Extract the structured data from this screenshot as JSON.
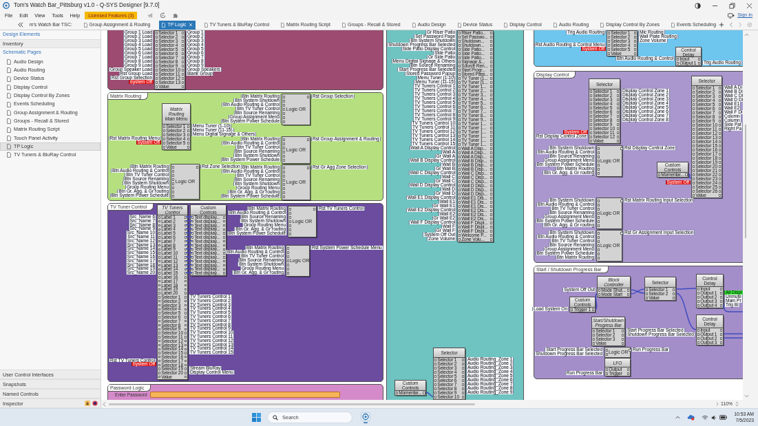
{
  "window": {
    "title": "Tom's Watch Bar_Pittsburg v1.0 - Q-SYS Designer [9.7.0]",
    "menu": [
      "File",
      "Edit",
      "View",
      "Tools",
      "Help"
    ],
    "license_badge": "Licensed Features (3)",
    "sign_in": "Sign In"
  },
  "tabs": [
    {
      "label": "m's Watch Bar TSC:",
      "kind": "partial",
      "selected": false
    },
    {
      "label": "Group Assignment & Routing",
      "kind": "page",
      "selected": false
    },
    {
      "label": "TP Logic",
      "kind": "page",
      "selected": true
    },
    {
      "label": "TV Tuners & BluRay Control",
      "kind": "page",
      "selected": false
    },
    {
      "label": "Matrix Routing Script",
      "kind": "page",
      "selected": false
    },
    {
      "label": "Groups - Recall & Stored",
      "kind": "page",
      "selected": false
    },
    {
      "label": "Audio Design",
      "kind": "page",
      "selected": false
    },
    {
      "label": "Device Status",
      "kind": "page",
      "selected": false
    },
    {
      "label": "Display Control",
      "kind": "page",
      "selected": false
    },
    {
      "label": "Audio Routing",
      "kind": "page",
      "selected": false
    },
    {
      "label": "Display Control By Zones",
      "kind": "page",
      "selected": false
    },
    {
      "label": "Events Scheduling",
      "kind": "page",
      "selected": false
    }
  ],
  "sidebar": {
    "headers": [
      {
        "label": "Design Elements",
        "kind": "link"
      },
      {
        "label": "Inventory",
        "kind": "header"
      },
      {
        "label": "Schematic Pages",
        "kind": "link"
      }
    ],
    "pages": [
      {
        "label": "Audio Design",
        "selected": false
      },
      {
        "label": "Audio Routing",
        "selected": false
      },
      {
        "label": "Device Status",
        "selected": false
      },
      {
        "label": "Display Control",
        "selected": false
      },
      {
        "label": "Display Control By Zones",
        "selected": false
      },
      {
        "label": "Events Scheduling",
        "selected": false
      },
      {
        "label": "Group Assignment & Routing",
        "selected": false
      },
      {
        "label": "Groups - Recall & Stored",
        "selected": false
      },
      {
        "label": "Matrix Routing Script",
        "selected": false
      },
      {
        "label": "Touch Panel Activity",
        "selected": false
      },
      {
        "label": "TP Logic",
        "selected": true
      },
      {
        "label": "TV Tuners & BluRay Control",
        "selected": false
      }
    ],
    "panels": [
      {
        "label": "User Control Interfaces",
        "kind": "section"
      },
      {
        "label": "Snapshots",
        "kind": "section"
      },
      {
        "label": "Named Controls",
        "kind": "section"
      },
      {
        "label": "Inspector",
        "kind": "inspector"
      }
    ]
  },
  "canvas": {
    "zoom": "110%",
    "groups": [
      {
        "color": "#9d4b71",
        "blocks": [
          {
            "kind": "component",
            "rows": [
              {
                "in": "Group 1 Load",
                "label": "Selector 1",
                "out": "Group 1"
              },
              {
                "in": "Group 2 Load",
                "label": "Selector 2",
                "out": "Group 2"
              },
              {
                "in": "Group 3 Load",
                "label": "Selector 3",
                "out": "Group 3"
              },
              {
                "in": "Group 4 Load",
                "label": "Selector 4",
                "out": "Group 4"
              },
              {
                "in": "Group 5 Load",
                "label": "Selector 5",
                "out": "Group 5"
              },
              {
                "in": "Group 6 Load",
                "label": "Selector 6",
                "out": "Group 6"
              },
              {
                "in": "Group 7 Load",
                "label": "Selector 7",
                "out": "Group 7"
              },
              {
                "in": "Group 8 Load",
                "label": "Selector 8",
                "out": "Group 8"
              },
              {
                "in": "Group 9 Load",
                "label": "Selector 9",
                "out": "Group 9"
              },
              {
                "in": "Group Speaker Load",
                "label": "Selector 10",
                "out": "Group Speakers"
              },
              {
                "in": "Rst Group Load",
                "label": "Selector 11",
                "out": "Blank Group"
              },
              {
                "in": "Rst Group Selection",
                "label": "Selector 12"
              },
              {
                "tag": "System Off",
                "label": "Selector 13"
              },
              {
                "label": "Value"
              }
            ]
          }
        ]
      },
      {
        "title": "Matrix Routing",
        "color": "#b6e07f",
        "blocks": [
          {
            "kind": "renamed",
            "title": "Matrix Routing Main Menu",
            "rows": [
              {
                "label": "Selector 1",
                "out": "Menu Tuner (1-10)"
              },
              {
                "label": "Selector 2",
                "out": "Menu Tuner (11-15)"
              },
              {
                "label": "Selector 3",
                "out": "Menu Digital Signage & Others"
              },
              {
                "in": "Rst Matrix Routing Menu",
                "label": "Selector 4"
              },
              {
                "tag": "System Off",
                "label": "Selector 5"
              },
              {
                "label": "Value"
              }
            ]
          },
          {
            "kind": "logic",
            "title": "Logic OR",
            "rows": [
              {
                "in": "Btn Matrix Routing",
                "out": "Rst Group Selection"
              },
              {
                "in": "Btn System Shutdown"
              },
              {
                "in": "Btn Audio Routing & Control"
              },
              {
                "in": "Btn TV Tuner Control"
              },
              {
                "in": "Btn Source Renaming"
              },
              {
                "in": "Group Assignment Menu"
              },
              {
                "in": "Btn System Power Schedule"
              }
            ]
          },
          {
            "kind": "logic",
            "title": "Logic OR",
            "rows": [
              {
                "in": "Btn Matrix Routing",
                "out": "Rst Group Assignment & Routing"
              },
              {
                "in": "Btn Audio Routing & Control"
              },
              {
                "in": "Btn TV Tuner Control"
              },
              {
                "in": "Btn Source Renaming"
              },
              {
                "in": "Btn System Shutdown"
              },
              {
                "in": "Btn System Power Schedule"
              }
            ]
          },
          {
            "kind": "logic",
            "title": "Logic OR",
            "rows": [
              {
                "in": "Btn Matrix Routing",
                "out": "Rst Zone Selection"
              },
              {
                "in": "Btn Audio Routing & Control"
              },
              {
                "in": "Btn TV Tuner Control"
              },
              {
                "in": "Btn Source Renaming"
              },
              {
                "in": "Btn System Shutdown"
              },
              {
                "in": "Group Routing Menu"
              },
              {
                "in": "Btn Gr. Agg. & Gr routing"
              },
              {
                "in": "Btn System Power Schedule"
              }
            ]
          },
          {
            "kind": "logic",
            "title": "Logic OR",
            "rows": [
              {
                "in": "Btn Matrix Routing",
                "out": "Rst Gr Agg Zone Selection"
              },
              {
                "in": "Btn Audio Routing & Control"
              },
              {
                "in": "Btn TV Tuner Control"
              },
              {
                "in": "Btn Source Renaming"
              },
              {
                "in": "Btn System Shutdown"
              },
              {
                "in": "Group Routing Menu"
              },
              {
                "in": "Btn Gr. Agg. & Gr routing"
              },
              {
                "in": "Btn System Power Schedule"
              }
            ]
          }
        ]
      },
      {
        "title": "TV Tuner Control",
        "color": "#6b4c9f",
        "blocks": [
          {
            "kind": "renamed",
            "title": "TV Tuners Control",
            "rows": [
              {
                "in": "Src_Name 6",
                "label": "Label 1"
              },
              {
                "in": "Src_Name 7",
                "label": "Label 2"
              },
              {
                "in": "Src_Name 8",
                "label": "Label 3"
              },
              {
                "in": "Src_Name 9",
                "label": "Label 4"
              },
              {
                "in": "Src_Name 10",
                "label": "Label 5"
              },
              {
                "in": "Src_Name 11",
                "label": "Label 6"
              },
              {
                "in": "Src_Name 12",
                "label": "Label 7"
              },
              {
                "in": "Src_Name 13",
                "label": "Label 8"
              },
              {
                "in": "Src_Name 14",
                "label": "Label 9"
              },
              {
                "in": "Src_Name 15",
                "label": "Label 10"
              },
              {
                "in": "Src_Name 16",
                "label": "Label 11"
              },
              {
                "in": "Src_Name 17",
                "label": "Label 12"
              },
              {
                "in": "Src_Name 18",
                "label": "Label 13"
              },
              {
                "in": "Src_Name 19",
                "label": "Label 14"
              },
              {
                "in": "Src_Name 20",
                "label": "Label 15"
              },
              {
                "label": "Label 16"
              },
              {
                "label": "Label 17"
              },
              {
                "label": "Label 18"
              },
              {
                "label": "Label 19"
              },
              {
                "label": "Label 20"
              },
              {
                "label": "Selector 1",
                "out": "TV Tuners Control 1"
              },
              {
                "label": "Selector 2",
                "out": "TV Tuners Control 2"
              },
              {
                "label": "Selector 3",
                "out": "TV Tuners Control 3"
              },
              {
                "label": "Selector 4",
                "out": "TV Tuners Control 4"
              },
              {
                "label": "Selector 5",
                "out": "TV Tuners Control 5"
              },
              {
                "label": "Selector 6",
                "out": "TV Tuners Control 6"
              },
              {
                "label": "Selector 7",
                "out": "TV Tuners Control 7"
              },
              {
                "label": "Selector 8",
                "out": "TV Tuners Control 8"
              },
              {
                "label": "Selector 9",
                "out": "TV Tuners Control 9"
              },
              {
                "label": "Selector 10",
                "out": "TV Tuners Control 10"
              },
              {
                "label": "Selector 11",
                "out": "TV Tuners Control 11"
              },
              {
                "label": "Selector 12",
                "out": "TV Tuners Control 12"
              },
              {
                "label": "Selector 13",
                "out": "TV Tuners Control 13"
              },
              {
                "label": "Selector 14",
                "out": "TV Tuners Control 14"
              },
              {
                "label": "Selector 15",
                "out": "TV Tuners Control 15"
              },
              {
                "label": "Selector 16"
              },
              {
                "in": "Rst TV Tuners Control",
                "label": "Selector 17"
              },
              {
                "tag": "System Off",
                "label": "Selector 18"
              },
              {
                "label": "Selector 19",
                "out": "Stream BluRay"
              },
              {
                "label": "Selector 20",
                "out": "Display Control Menu"
              },
              {
                "label": "Value"
              }
            ]
          },
          {
            "kind": "component",
            "title": "Custom Controls",
            "rows": [
              {
                "label": "Text display..."
              },
              {
                "label": "Text display..."
              },
              {
                "label": "Text display..."
              },
              {
                "label": "Text display..."
              },
              {
                "label": "Text display..."
              },
              {
                "label": "Text display..."
              },
              {
                "label": "Text display..."
              },
              {
                "label": "Text display..."
              },
              {
                "label": "Text display..."
              },
              {
                "label": "Text display..."
              },
              {
                "label": "Text display..."
              },
              {
                "label": "Text display..."
              },
              {
                "label": "Text display..."
              },
              {
                "label": "Text display..."
              },
              {
                "label": "Text display..."
              }
            ]
          },
          {
            "kind": "logic",
            "title": "Logic OR",
            "rows": [
              {
                "in": "Btn Matrix Routing",
                "out": "Rst TV Tuners Control"
              },
              {
                "in": "Btn Audio Routing & Control"
              },
              {
                "in": "Btn Source Renaming"
              },
              {
                "in": "Btn System Shutdown"
              },
              {
                "in": "Group Routing Menu"
              },
              {
                "in": "Btn Gr. Agg. & Gr routing"
              },
              {
                "in": "Btn System Power Schedule"
              }
            ]
          },
          {
            "kind": "logic",
            "title": "Logic OR",
            "rows": [
              {
                "in": "Btn Matrix Routing",
                "out": "Rst System Power Schedule Menu"
              },
              {
                "in": "Btn Audio Routing & Control"
              },
              {
                "in": "Btn TV Tuner Control"
              },
              {
                "in": "Btn Source Renaming"
              },
              {
                "in": "Btn System Shutdown"
              },
              {
                "in": "Group Routing Menu"
              },
              {
                "in": "Btn Gr. Agg. & Gr routing"
              }
            ]
          }
        ]
      },
      {
        "title": "Password Logic",
        "color": "#d58ac9",
        "blocks": [
          {
            "kind": "entry",
            "label": "Enter Password"
          }
        ]
      },
      {
        "color": "#6fc3c0",
        "blocks": [
          {
            "kind": "component",
            "rows": [
              {
                "in": "Gr Riser Patio",
                "label": "Riser Patio..."
              },
              {
                "in": "Set Password Page",
                "label": "Set Passwo..."
              },
              {
                "in": "Btn System Shutdown",
                "label": "Shutdown..."
              },
              {
                "in": "Shutdown Progress Bar Selected",
                "label": "Shutdown..."
              },
              {
                "in": "Side Patio Display Control",
                "label": "Side Patio..."
              },
              {
                "in": "Side Patio",
                "label": "Side Patio..."
              },
              {
                "in": "Gr Side Patio",
                "label": "Side Patio..."
              },
              {
                "in": "Menu Digital Signage & Others",
                "label": "Signage &..."
              },
              {
                "in": "Btn Source Renaming",
                "label": "Source Ren..."
              },
              {
                "in": "Start Progress Bar Selected",
                "label": "Start Progr..."
              },
              {
                "in": "Stored Password Popup",
                "label": "Stored Pass..."
              },
              {
                "in": "Menu Tuner (1-10)",
                "label": "TV Tuner (1..."
              },
              {
                "in": "Menu Tuner (11-15)",
                "label": "TV Tuner (1..."
              },
              {
                "in": "TV Tuners Control 1",
                "label": "TV Tuner 1..."
              },
              {
                "in": "TV Tuners Control 2",
                "label": "TV Tuner 2..."
              },
              {
                "in": "TV Tuners Control 3",
                "label": "TV Tuner 3..."
              },
              {
                "in": "TV Tuners Control 4",
                "label": "TV Tuner 4..."
              },
              {
                "in": "TV Tuners Control 5",
                "label": "TV Tuner 5..."
              },
              {
                "in": "TV Tuners Control 6",
                "label": "TV Tuner 6..."
              },
              {
                "in": "TV Tuners Control 7",
                "label": "TV Tuner 7..."
              },
              {
                "in": "TV Tuners Control 8",
                "label": "TV Tuner 8..."
              },
              {
                "in": "TV Tuners Control 9",
                "label": "TV Tuner 9..."
              },
              {
                "in": "TV Tuners Control 10",
                "label": "TV Tuner 1..."
              },
              {
                "in": "TV Tuners Control 11",
                "label": "TV Tuner 1..."
              },
              {
                "in": "TV Tuners Control 12",
                "label": "TV Tuner 1..."
              },
              {
                "in": "TV Tuners Control 13",
                "label": "TV Tuner 1..."
              },
              {
                "in": "TV Tuners Control 14",
                "label": "TV Tuner 1..."
              },
              {
                "in": "TV Tuners Control 15",
                "label": "TV Tuner 1..."
              },
              {
                "in": "Wall A Display Control",
                "label": "Wall A Disp..."
              },
              {
                "in": "Wall A",
                "label": "Wall A Disp..."
              },
              {
                "in": "Gr Wall A",
                "label": "Wall A Disp..."
              },
              {
                "in": "Wall B Display Control",
                "label": "Wall B Disp..."
              },
              {
                "in": "Wall B",
                "label": "Wall B Disp..."
              },
              {
                "in": "Gr Wall B",
                "label": "Wall B Disp..."
              },
              {
                "in": "Wall C Display Control",
                "label": "Wall C Disp..."
              },
              {
                "in": "Wall C",
                "label": "Wall C Disp..."
              },
              {
                "in": "Gr Wall C",
                "label": "Wall C Disp..."
              },
              {
                "in": "Wall D Display Control",
                "label": "Wall D Disp..."
              },
              {
                "in": "Wall D",
                "label": "Wall D Disp..."
              },
              {
                "in": "Gr Wall D",
                "label": "Wall D Disp..."
              },
              {
                "in": "Wall E1 Display Control",
                "label": "Wall E1 Dis..."
              },
              {
                "in": "Wall E1",
                "label": "Wall E1 Dis..."
              },
              {
                "in": "Gr Wall E1",
                "label": "Wall E1 Dis..."
              },
              {
                "in": "Wall E2 Display Control",
                "label": "Wall E2 Dis..."
              },
              {
                "in": "Wall E2",
                "label": "Wall E2 Dis..."
              },
              {
                "in": "Gr Wall E2",
                "label": "Wall E2 Dis..."
              },
              {
                "in": "Wall F Display Control",
                "label": "Wall F Displ..."
              },
              {
                "in": "Wall F",
                "label": "Wall F Displ..."
              },
              {
                "in": "Gr Wall F",
                "label": "Wall F Displ..."
              },
              {
                "in": "System Off Out",
                "label": "Welcome P..."
              },
              {
                "in": "Zone Volume",
                "label": "Zone Volu..."
              }
            ]
          },
          {
            "kind": "component",
            "title": "Custom Controls",
            "rows": [
              {
                "label": "Momentar..."
              }
            ]
          },
          {
            "kind": "component",
            "title": "Selector",
            "rows": [
              {
                "label": "Selector 1",
                "out": "Audio Routing_Zone 1"
              },
              {
                "label": "Selector 2",
                "out": "Audio Routing_Zone 2"
              },
              {
                "label": "Selector 3",
                "out": "Audio Routing_Zone 3"
              },
              {
                "label": "Selector 4",
                "out": "Audio Routing_Zone 4"
              },
              {
                "label": "Selector 5",
                "out": "Audio Routing_Zone 5"
              },
              {
                "label": "Selector 6",
                "out": "Audio Routing_Zone 6"
              },
              {
                "label": "Selector 7",
                "out": "Audio Routing_Zone 7"
              },
              {
                "label": "Selector 8",
                "out": "Audio Routing_Zone 8"
              },
              {
                "label": "Selector 9",
                "out": "Audio Routing_Zone 9"
              },
              {
                "label": "Selector 10"
              }
            ]
          }
        ]
      },
      {
        "color": "#6ec6ee",
        "blocks": [
          {
            "kind": "component",
            "rows": [
              {
                "in": "Trig Audio Routing",
                "label": "Selector 1",
                "out": "Mic Routing"
              },
              {
                "label": "Selector 2",
                "out": "Wall Plate Routing"
              },
              {
                "label": "Selector 3",
                "out": "Zone Volume"
              },
              {
                "in": "Rst Audio Routing & Control Menu",
                "label": "Selector 4"
              },
              {
                "tag": "System Off",
                "label": "Selector 5"
              },
              {
                "label": "Value"
              }
            ]
          },
          {
            "kind": "component",
            "title": "Control Delay",
            "rows": [
              {
                "in": "Btn Audio Routing & Control",
                "label": "Input"
              },
              {
                "label": "Output 1",
                "out": "Trig Audio Routing"
              }
            ]
          }
        ]
      },
      {
        "title": "Display Control",
        "color": "#a997cd",
        "blocks": [
          {
            "kind": "component",
            "title": "Selector",
            "rows": [
              {
                "label": "Selector 1",
                "out": "Display Control Zone 1"
              },
              {
                "label": "Selector 2",
                "out": "Display Control Zone 2"
              },
              {
                "label": "Selector 3",
                "out": "Display Control Zone 3"
              },
              {
                "label": "Selector 4",
                "out": "Display Control Zone 4"
              },
              {
                "label": "Selector 5",
                "out": "Display Control Zone 5"
              },
              {
                "label": "Selector 6",
                "out": "Display Control Zone 6"
              },
              {
                "label": "Selector 7",
                "out": "Display Control Zone 7"
              },
              {
                "label": "Selector 8",
                "out": "Display Control Zone 8"
              },
              {
                "label": "Selector 9"
              },
              {
                "label": "Selector 10"
              },
              {
                "tag": "System Off",
                "label": "Selector 11"
              },
              {
                "in": "Rst Display Control Zone",
                "label": "Selector 12"
              },
              {
                "label": "Value"
              }
            ]
          },
          {
            "kind": "logic",
            "title": "Logic OR",
            "rows": [
              {
                "in": "Btn System Shutdown",
                "out": "Rst Display Control Zone"
              },
              {
                "in": "Btn Audio Routing & Control"
              },
              {
                "in": "Btn Source Renaming"
              },
              {
                "in": "Group Assignment Menu"
              },
              {
                "in": "Btn System Power Schedule"
              },
              {
                "in": "Btn Matrix Routing"
              },
              {
                "in": "Btn Gr. Agg. & Gr routing"
              }
            ]
          },
          {
            "kind": "component",
            "title": "Custom Controls",
            "rows": [
              {
                "label": "Momentar..."
              }
            ]
          },
          {
            "kind": "component",
            "title": "Selector",
            "rows": [
              {
                "label": "Selector 1",
                "out": "Wall A Di"
              },
              {
                "label": "Selector 2",
                "out": "Wall B Di"
              },
              {
                "label": "Selector 3",
                "out": "Wall C Di"
              },
              {
                "label": "Selector 4",
                "out": "Wall D Di"
              },
              {
                "label": "Selector 5",
                "out": "Wall E1"
              },
              {
                "label": "Selector 6",
                "out": "Wall E2"
              },
              {
                "label": "Selector 7",
                "out": "Wall F Di"
              },
              {
                "label": "Selector 8",
                "out": "Column"
              },
              {
                "label": "Selector 9",
                "out": "Column"
              },
              {
                "label": "Selector 10",
                "out": "Side Pat"
              },
              {
                "label": "Selector 11",
                "out": "Right Pa"
              },
              {
                "label": "Selector 12"
              },
              {
                "label": "Selector 13"
              },
              {
                "label": "Selector 14"
              },
              {
                "label": "Selector 15"
              },
              {
                "label": "Selector 16"
              },
              {
                "label": "Selector 17"
              },
              {
                "label": "Selector 18"
              },
              {
                "label": "Selector 19"
              },
              {
                "label": "Selector 20"
              },
              {
                "label": "Selector 21"
              },
              {
                "label": "Selector 22"
              },
              {
                "label": "Selector 23"
              },
              {
                "tag": "System Off",
                "label": "Selector 24"
              },
              {
                "label": "Selector 25"
              },
              {
                "label": "Selector 26"
              },
              {
                "label": "Value"
              }
            ]
          },
          {
            "kind": "logic",
            "title": "Logic OR",
            "rows": [
              {
                "in": "Btn System Shutdown",
                "out": "Rst Matrix Routing Input Selection"
              },
              {
                "in": "Btn Audio Routing & Control"
              },
              {
                "in": "Btn TV Tuner Control"
              },
              {
                "in": "Btn Source Renaming"
              },
              {
                "in": "Group Assignment Menu"
              },
              {
                "in": "Btn System Power Schedule"
              },
              {
                "in": "Btn Gr. Agg. & Gr routing"
              }
            ]
          },
          {
            "kind": "logic",
            "title": "Logic OR",
            "rows": [
              {
                "in": "Btn System Shutdown",
                "out": "Rst Gr Assignment Input Selection"
              },
              {
                "in": "Btn Audio Routing & Control"
              },
              {
                "in": "Btn TV Tuner Control"
              },
              {
                "in": "Btn Source Renaming"
              },
              {
                "in": "Group Assignment Menu"
              },
              {
                "in": "Btn System Power Schedule"
              },
              {
                "in": "Btn Matrix Routing"
              }
            ]
          }
        ]
      },
      {
        "title": "Start / Shutdown Progress Bar",
        "color": "#a48ec9",
        "blocks": [
          {
            "kind": "renamed",
            "title": "Block Controller",
            "rows": [
              {
                "in": "System Off Out",
                "label": "Mode Shut..."
              },
              {
                "label": "Mode Start"
              }
            ]
          },
          {
            "kind": "component",
            "title": "Custom Controls",
            "rows": [
              {
                "in": "Load System On",
                "label": "Trigger 1"
              }
            ]
          },
          {
            "kind": "component",
            "title": "Selector",
            "rows": [
              {
                "label": "Selector 1"
              },
              {
                "label": "Selector 2"
              },
              {
                "label": "Value"
              }
            ]
          },
          {
            "kind": "component",
            "title": "Control Delay",
            "rows": [
              {
                "label": "Input"
              },
              {
                "label": "Output 1",
                "lit": "All Displ"
              },
              {
                "label": "Output 2",
                "out": "Unmute"
              },
              {
                "label": "Output 3",
                "out": "Main Pr"
              },
              {
                "label": "Output 4",
                "out": "Trig Bl"
              }
            ]
          },
          {
            "kind": "renamed",
            "title": "Start/Shutdown Progress Bar",
            "rows": [
              {
                "label": "Selector 1",
                "out": "Start Progress Bar Selected"
              },
              {
                "label": "Selector 2",
                "out": "Shutdown Progress Bar Selected"
              },
              {
                "label": "Selector 3"
              },
              {
                "label": "Value"
              }
            ]
          },
          {
            "kind": "logic",
            "title": "Logic OR",
            "rows": [
              {
                "in": "Start Progress Bar Selected",
                "out": "Run Progress Bar"
              },
              {
                "in": "Shutdown Progress Bar Selected"
              }
            ]
          },
          {
            "kind": "component",
            "title": "LFO",
            "rows": [
              {
                "label": "Output"
              },
              {
                "in": "Run Progress Bar",
                "label": "Trigger"
              }
            ]
          },
          {
            "kind": "component",
            "title": "Control Delay",
            "rows": [
              {
                "label": "Input"
              },
              {
                "label": "Output 1"
              },
              {
                "label": "Output 2"
              },
              {
                "label": "Output 3"
              }
            ]
          }
        ]
      }
    ]
  },
  "taskbar": {
    "search": {
      "placeholder": "Search"
    },
    "time": "10:53 AM",
    "date": "7/5/2023"
  }
}
